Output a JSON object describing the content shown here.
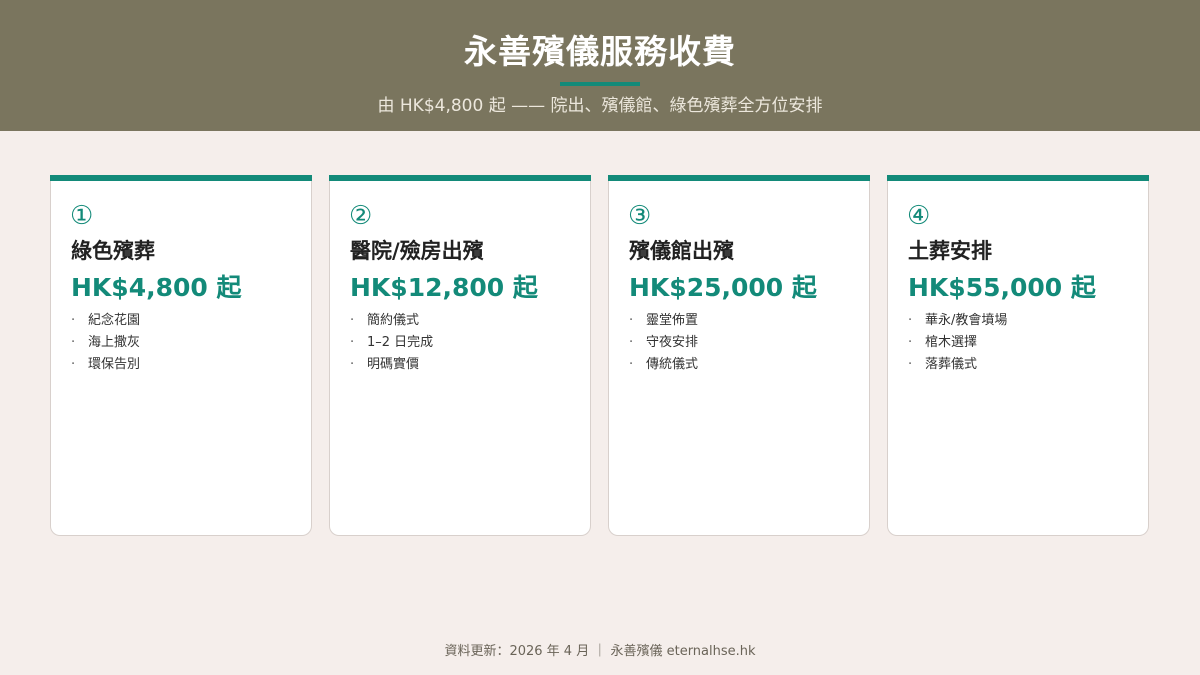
{
  "header": {
    "title": "永善殯儀服務收費",
    "subtitle": "由 HK$4,800 起 —— 院出、殯儀館、綠色殯葬全方位安排",
    "background_color": "#7a755e",
    "accent_color": "#138a79"
  },
  "cards": [
    {
      "number": "①",
      "title": "綠色殯葬",
      "price": "HK$4,800 起",
      "items": [
        "紀念花園",
        "海上撒灰",
        "環保告別"
      ]
    },
    {
      "number": "②",
      "title": "醫院/殮房出殯",
      "price": "HK$12,800 起",
      "items": [
        "簡約儀式",
        "1–2 日完成",
        "明碼實價"
      ]
    },
    {
      "number": "③",
      "title": "殯儀館出殯",
      "price": "HK$25,000 起",
      "items": [
        "靈堂佈置",
        "守夜安排",
        "傳統儀式"
      ]
    },
    {
      "number": "④",
      "title": "土葬安排",
      "price": "HK$55,000 起",
      "items": [
        "華永/教會墳場",
        "棺木選擇",
        "落葬儀式"
      ]
    }
  ],
  "bullet": "·",
  "footer": {
    "text": "資料更新：2026 年 4 月 ｜ 永善殯儀 eternalhse.hk"
  },
  "page_background_color": "#f5eeeb"
}
